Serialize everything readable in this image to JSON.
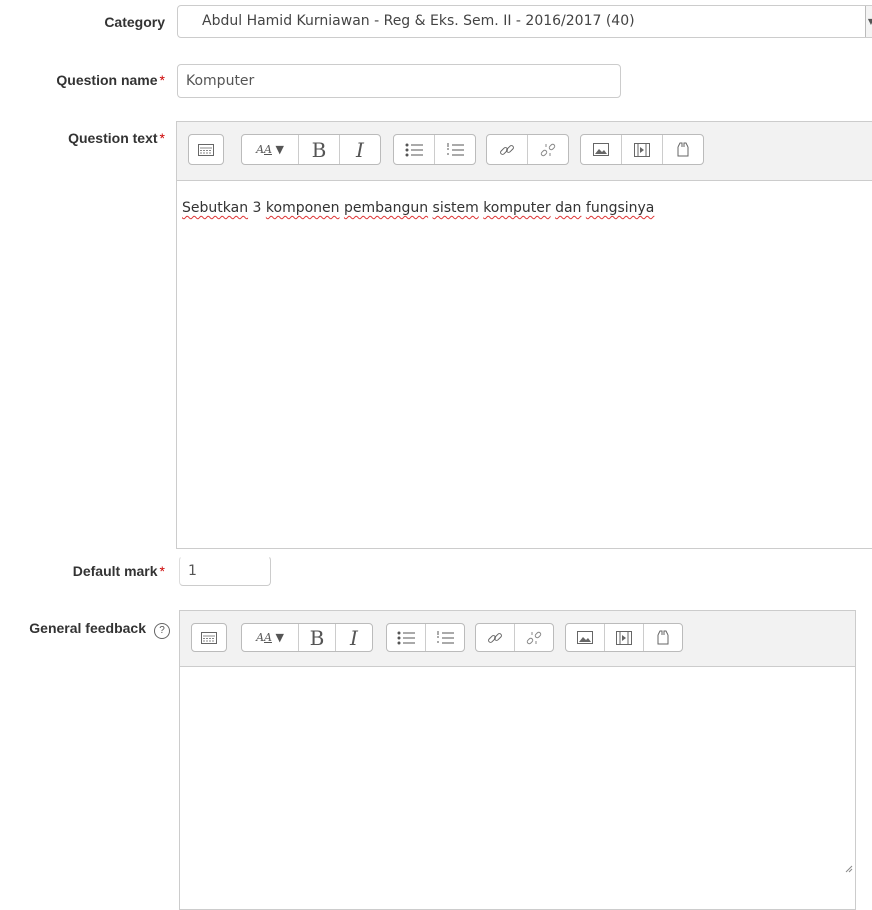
{
  "category": {
    "label": "Category",
    "value": "Abdul Hamid Kurniawan - Reg & Eks. Sem. II - 2016/2017 (40)"
  },
  "question_name": {
    "label": "Question name",
    "required_mark": "*",
    "value": "Komputer"
  },
  "question_text": {
    "label": "Question text",
    "required_mark": "*",
    "words": [
      "Sebutkan",
      "3",
      "komponen",
      "pembangun",
      "sistem",
      "komputer",
      "dan",
      "fungsinya"
    ]
  },
  "default_mark": {
    "label": "Default mark",
    "required_mark": "*",
    "value": "1"
  },
  "general_feedback": {
    "label": "General feedback",
    "help_glyph": "?",
    "value": ""
  },
  "toolbar": {
    "icons": [
      "collapse-toolbar-icon",
      "font-style-icon",
      "bold-icon",
      "italic-icon",
      "unordered-list-icon",
      "ordered-list-icon",
      "link-icon",
      "unlink-icon",
      "image-icon",
      "media-icon",
      "manage-files-icon"
    ],
    "bold_glyph": "B",
    "italic_glyph": "I"
  },
  "colors": {
    "required": "#cc0000",
    "toolbar_bg": "#f2f2f2",
    "border": "#cccccc"
  }
}
